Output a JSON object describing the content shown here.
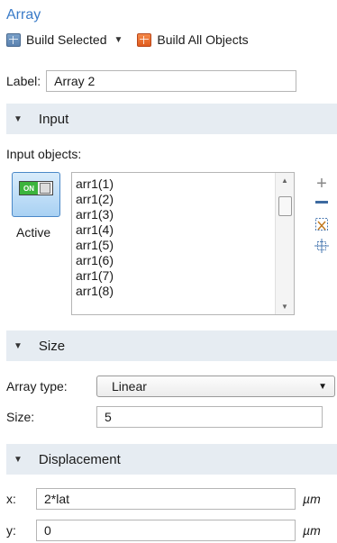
{
  "title": "Array",
  "toolbar": {
    "build_selected": "Build Selected",
    "build_all": "Build All Objects"
  },
  "label_field": {
    "label": "Label:",
    "value": "Array 2"
  },
  "sections": {
    "input": "Input",
    "size": "Size",
    "displacement": "Displacement"
  },
  "input": {
    "objects_label": "Input objects:",
    "toggle_text": "ON",
    "active_label": "Active",
    "items": [
      "arr1(1)",
      "arr1(2)",
      "arr1(3)",
      "arr1(4)",
      "arr1(5)",
      "arr1(6)",
      "arr1(7)",
      "arr1(8)"
    ]
  },
  "size": {
    "array_type_label": "Array type:",
    "array_type_value": "Linear",
    "size_label": "Size:",
    "size_value": "5"
  },
  "displacement": {
    "x_label": "x:",
    "x_value": "2*lat",
    "x_unit": "µm",
    "y_label": "y:",
    "y_value": "0",
    "y_unit": "µm"
  }
}
